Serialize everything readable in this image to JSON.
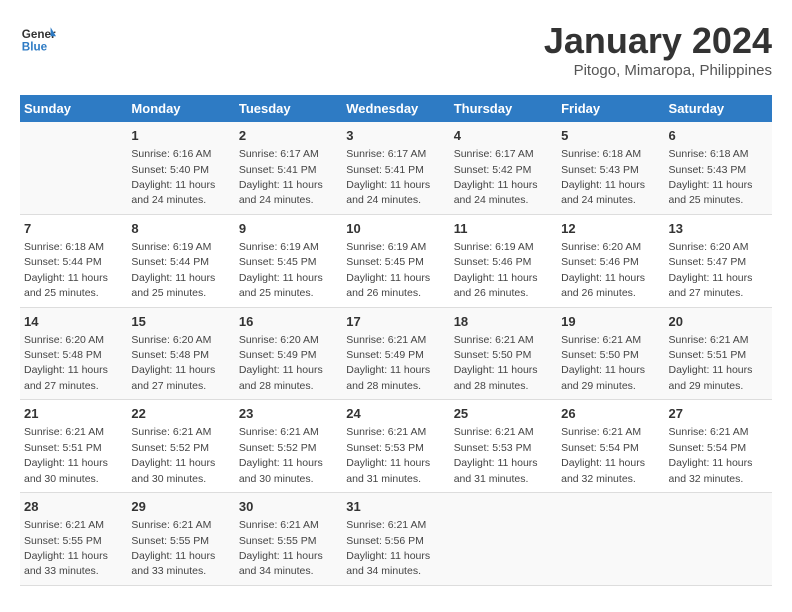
{
  "header": {
    "logo_line1": "General",
    "logo_line2": "Blue",
    "month_title": "January 2024",
    "location": "Pitogo, Mimaropa, Philippines"
  },
  "days_of_week": [
    "Sunday",
    "Monday",
    "Tuesday",
    "Wednesday",
    "Thursday",
    "Friday",
    "Saturday"
  ],
  "weeks": [
    [
      {
        "num": "",
        "sunrise": "",
        "sunset": "",
        "daylight": ""
      },
      {
        "num": "1",
        "sunrise": "Sunrise: 6:16 AM",
        "sunset": "Sunset: 5:40 PM",
        "daylight": "Daylight: 11 hours and 24 minutes."
      },
      {
        "num": "2",
        "sunrise": "Sunrise: 6:17 AM",
        "sunset": "Sunset: 5:41 PM",
        "daylight": "Daylight: 11 hours and 24 minutes."
      },
      {
        "num": "3",
        "sunrise": "Sunrise: 6:17 AM",
        "sunset": "Sunset: 5:41 PM",
        "daylight": "Daylight: 11 hours and 24 minutes."
      },
      {
        "num": "4",
        "sunrise": "Sunrise: 6:17 AM",
        "sunset": "Sunset: 5:42 PM",
        "daylight": "Daylight: 11 hours and 24 minutes."
      },
      {
        "num": "5",
        "sunrise": "Sunrise: 6:18 AM",
        "sunset": "Sunset: 5:43 PM",
        "daylight": "Daylight: 11 hours and 24 minutes."
      },
      {
        "num": "6",
        "sunrise": "Sunrise: 6:18 AM",
        "sunset": "Sunset: 5:43 PM",
        "daylight": "Daylight: 11 hours and 25 minutes."
      }
    ],
    [
      {
        "num": "7",
        "sunrise": "Sunrise: 6:18 AM",
        "sunset": "Sunset: 5:44 PM",
        "daylight": "Daylight: 11 hours and 25 minutes."
      },
      {
        "num": "8",
        "sunrise": "Sunrise: 6:19 AM",
        "sunset": "Sunset: 5:44 PM",
        "daylight": "Daylight: 11 hours and 25 minutes."
      },
      {
        "num": "9",
        "sunrise": "Sunrise: 6:19 AM",
        "sunset": "Sunset: 5:45 PM",
        "daylight": "Daylight: 11 hours and 25 minutes."
      },
      {
        "num": "10",
        "sunrise": "Sunrise: 6:19 AM",
        "sunset": "Sunset: 5:45 PM",
        "daylight": "Daylight: 11 hours and 26 minutes."
      },
      {
        "num": "11",
        "sunrise": "Sunrise: 6:19 AM",
        "sunset": "Sunset: 5:46 PM",
        "daylight": "Daylight: 11 hours and 26 minutes."
      },
      {
        "num": "12",
        "sunrise": "Sunrise: 6:20 AM",
        "sunset": "Sunset: 5:46 PM",
        "daylight": "Daylight: 11 hours and 26 minutes."
      },
      {
        "num": "13",
        "sunrise": "Sunrise: 6:20 AM",
        "sunset": "Sunset: 5:47 PM",
        "daylight": "Daylight: 11 hours and 27 minutes."
      }
    ],
    [
      {
        "num": "14",
        "sunrise": "Sunrise: 6:20 AM",
        "sunset": "Sunset: 5:48 PM",
        "daylight": "Daylight: 11 hours and 27 minutes."
      },
      {
        "num": "15",
        "sunrise": "Sunrise: 6:20 AM",
        "sunset": "Sunset: 5:48 PM",
        "daylight": "Daylight: 11 hours and 27 minutes."
      },
      {
        "num": "16",
        "sunrise": "Sunrise: 6:20 AM",
        "sunset": "Sunset: 5:49 PM",
        "daylight": "Daylight: 11 hours and 28 minutes."
      },
      {
        "num": "17",
        "sunrise": "Sunrise: 6:21 AM",
        "sunset": "Sunset: 5:49 PM",
        "daylight": "Daylight: 11 hours and 28 minutes."
      },
      {
        "num": "18",
        "sunrise": "Sunrise: 6:21 AM",
        "sunset": "Sunset: 5:50 PM",
        "daylight": "Daylight: 11 hours and 28 minutes."
      },
      {
        "num": "19",
        "sunrise": "Sunrise: 6:21 AM",
        "sunset": "Sunset: 5:50 PM",
        "daylight": "Daylight: 11 hours and 29 minutes."
      },
      {
        "num": "20",
        "sunrise": "Sunrise: 6:21 AM",
        "sunset": "Sunset: 5:51 PM",
        "daylight": "Daylight: 11 hours and 29 minutes."
      }
    ],
    [
      {
        "num": "21",
        "sunrise": "Sunrise: 6:21 AM",
        "sunset": "Sunset: 5:51 PM",
        "daylight": "Daylight: 11 hours and 30 minutes."
      },
      {
        "num": "22",
        "sunrise": "Sunrise: 6:21 AM",
        "sunset": "Sunset: 5:52 PM",
        "daylight": "Daylight: 11 hours and 30 minutes."
      },
      {
        "num": "23",
        "sunrise": "Sunrise: 6:21 AM",
        "sunset": "Sunset: 5:52 PM",
        "daylight": "Daylight: 11 hours and 30 minutes."
      },
      {
        "num": "24",
        "sunrise": "Sunrise: 6:21 AM",
        "sunset": "Sunset: 5:53 PM",
        "daylight": "Daylight: 11 hours and 31 minutes."
      },
      {
        "num": "25",
        "sunrise": "Sunrise: 6:21 AM",
        "sunset": "Sunset: 5:53 PM",
        "daylight": "Daylight: 11 hours and 31 minutes."
      },
      {
        "num": "26",
        "sunrise": "Sunrise: 6:21 AM",
        "sunset": "Sunset: 5:54 PM",
        "daylight": "Daylight: 11 hours and 32 minutes."
      },
      {
        "num": "27",
        "sunrise": "Sunrise: 6:21 AM",
        "sunset": "Sunset: 5:54 PM",
        "daylight": "Daylight: 11 hours and 32 minutes."
      }
    ],
    [
      {
        "num": "28",
        "sunrise": "Sunrise: 6:21 AM",
        "sunset": "Sunset: 5:55 PM",
        "daylight": "Daylight: 11 hours and 33 minutes."
      },
      {
        "num": "29",
        "sunrise": "Sunrise: 6:21 AM",
        "sunset": "Sunset: 5:55 PM",
        "daylight": "Daylight: 11 hours and 33 minutes."
      },
      {
        "num": "30",
        "sunrise": "Sunrise: 6:21 AM",
        "sunset": "Sunset: 5:55 PM",
        "daylight": "Daylight: 11 hours and 34 minutes."
      },
      {
        "num": "31",
        "sunrise": "Sunrise: 6:21 AM",
        "sunset": "Sunset: 5:56 PM",
        "daylight": "Daylight: 11 hours and 34 minutes."
      },
      {
        "num": "",
        "sunrise": "",
        "sunset": "",
        "daylight": ""
      },
      {
        "num": "",
        "sunrise": "",
        "sunset": "",
        "daylight": ""
      },
      {
        "num": "",
        "sunrise": "",
        "sunset": "",
        "daylight": ""
      }
    ]
  ]
}
